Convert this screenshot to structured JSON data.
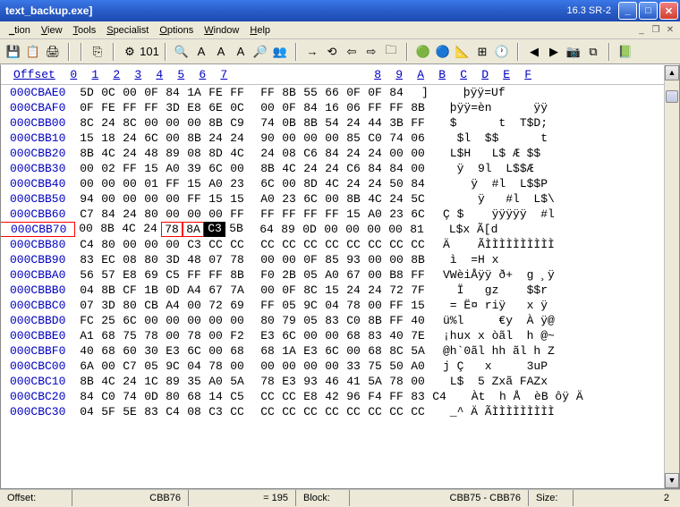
{
  "window": {
    "title": "text_backup.exe]",
    "version": "16.3 SR-2"
  },
  "menu": [
    "_tion",
    "View",
    "Tools",
    "Specialist",
    "Options",
    "Window",
    "Help"
  ],
  "toolbar_icons": [
    "💾",
    "📋",
    "🖨",
    "",
    "",
    "⎘",
    "",
    "⚙",
    "101",
    "",
    "🔍",
    "A",
    "A",
    "A",
    "🔎",
    "👥",
    "",
    "→",
    "⟲",
    "⇦",
    "⇨",
    "🗀",
    "",
    "🟢",
    "🔵",
    "📐",
    "⊞",
    "🕐",
    "",
    "◀",
    "▶",
    "📷",
    "⧉",
    "",
    "📗"
  ],
  "hex": {
    "header_offset": "Offset",
    "cols": [
      "0",
      "1",
      "2",
      "3",
      "4",
      "5",
      "6",
      "7",
      "8",
      "9",
      "A",
      "B",
      "C",
      "D",
      "E",
      "F"
    ],
    "rows": [
      {
        "o": "000CBAE0",
        "h": [
          "5D",
          "0C",
          "00",
          "0F",
          "84",
          "1A",
          "FE",
          "FF",
          "FF",
          "8B",
          "55",
          "66",
          "0F",
          "0F",
          "84"
        ],
        "a": "]     þÿÿ=Uf    "
      },
      {
        "o": "000CBAF0",
        "h": [
          "0F",
          "FE",
          "FF",
          "FF",
          "3D",
          "E8",
          "6E",
          "0C",
          "00",
          "0F",
          "84",
          "16",
          "06",
          "FF",
          "FF",
          "8B"
        ],
        "a": " þÿÿ=èn      ÿÿ "
      },
      {
        "o": "000CBB00",
        "h": [
          "8C",
          "24",
          "8C",
          "00",
          "00",
          "00",
          "8B",
          "C9",
          "74",
          "0B",
          "8B",
          "54",
          "24",
          "44",
          "3B",
          "FF"
        ],
        "a": " $      t  T$D; "
      },
      {
        "o": "000CBB10",
        "h": [
          "15",
          "18",
          "24",
          "6C",
          "00",
          "8B",
          "24",
          "24",
          "90",
          "00",
          "00",
          "00",
          "85",
          "C0",
          "74",
          "06"
        ],
        "a": "  $l  $$      t "
      },
      {
        "o": "000CBB20",
        "h": [
          "8B",
          "4C",
          "24",
          "48",
          "89",
          "08",
          "8D",
          "4C",
          "24",
          "08",
          "C6",
          "84",
          "24",
          "24",
          "00",
          "00"
        ],
        "a": " L$H   L$ Æ $$  "
      },
      {
        "o": "000CBB30",
        "h": [
          "00",
          "02",
          "FF",
          "15",
          "A0",
          "39",
          "6C",
          "00",
          "8B",
          "4C",
          "24",
          "24",
          "C6",
          "84",
          "84",
          "00"
        ],
        "a": "  ÿ  9l  L$$Æ   "
      },
      {
        "o": "000CBB40",
        "h": [
          "00",
          "00",
          "00",
          "01",
          "FF",
          "15",
          "A0",
          "23",
          "6C",
          "00",
          "8D",
          "4C",
          "24",
          "24",
          "50",
          "84"
        ],
        "a": "    ÿ  #l  L$$P "
      },
      {
        "o": "000CBB50",
        "h": [
          "94",
          "00",
          "00",
          "00",
          "00",
          "FF",
          "15",
          "15",
          "A0",
          "23",
          "6C",
          "00",
          "8B",
          "4C",
          "24",
          "5C"
        ],
        "a": "     ÿ   #l  L$\\"
      },
      {
        "o": "000CBB60",
        "h": [
          "C7",
          "84",
          "24",
          "80",
          "00",
          "00",
          "00",
          "FF",
          "FF",
          "FF",
          "FF",
          "FF",
          "15",
          "A0",
          "23",
          "6C"
        ],
        "a": "Ç $    ÿÿÿÿÿ  #l"
      },
      {
        "o": "000CBB70",
        "h": [
          "00",
          "8B",
          "4C",
          "24",
          "78",
          "8A",
          "C3",
          "5B",
          "64",
          "89",
          "0D",
          "00",
          "00",
          "00",
          "00",
          "81"
        ],
        "a": " L$x Ã[d        "
      },
      {
        "o": "000CBB80",
        "h": [
          "C4",
          "80",
          "00",
          "00",
          "00",
          "C3",
          "CC",
          "CC",
          "CC",
          "CC",
          "CC",
          "CC",
          "CC",
          "CC",
          "CC",
          "CC"
        ],
        "a": "Ä    ÃÌÌÌÌÌÌÌÌÌÌ"
      },
      {
        "o": "000CBB90",
        "h": [
          "83",
          "EC",
          "08",
          "80",
          "3D",
          "48",
          "07",
          "78",
          "00",
          "00",
          "0F",
          "85",
          "93",
          "00",
          "00",
          "8B"
        ],
        "a": " ì  =H x        "
      },
      {
        "o": "000CBBA0",
        "h": [
          "56",
          "57",
          "E8",
          "69",
          "C5",
          "FF",
          "FF",
          "8B",
          "F0",
          "2B",
          "05",
          "A0",
          "67",
          "00",
          "B8",
          "FF"
        ],
        "a": "VWèiÅÿÿ ð+  g ¸ÿ"
      },
      {
        "o": "000CBBB0",
        "h": [
          "04",
          "8B",
          "CF",
          "1B",
          "0D",
          "A4",
          "67",
          "7A",
          "00",
          "0F",
          "8C",
          "15",
          "24",
          "24",
          "72",
          "7F"
        ],
        "a": "  Ï   gz    $$r "
      },
      {
        "o": "000CBBC0",
        "h": [
          "07",
          "3D",
          "80",
          "CB",
          "A4",
          "00",
          "72",
          "69",
          "FF",
          "05",
          "9C",
          "04",
          "78",
          "00",
          "FF",
          "15"
        ],
        "a": " = Ë¤ riÿ   x ÿ "
      },
      {
        "o": "000CBBD0",
        "h": [
          "FC",
          "25",
          "6C",
          "00",
          "00",
          "00",
          "00",
          "00",
          "80",
          "79",
          "05",
          "83",
          "C0",
          "8B",
          "FF",
          "40"
        ],
        "a": "ü%l     €y  À ÿ@"
      },
      {
        "o": "000CBBE0",
        "h": [
          "A1",
          "68",
          "75",
          "78",
          "00",
          "78",
          "00",
          "F2",
          "E3",
          "6C",
          "00",
          "00",
          "68",
          "83",
          "40",
          "7E"
        ],
        "a": "¡hux x òãl  h @~"
      },
      {
        "o": "000CBBF0",
        "h": [
          "40",
          "68",
          "60",
          "30",
          "E3",
          "6C",
          "00",
          "68",
          "68",
          "1A",
          "E3",
          "6C",
          "00",
          "68",
          "8C",
          "5A"
        ],
        "a": "@h`0ãl hh ãl h Z"
      },
      {
        "o": "000CBC00",
        "h": [
          "6A",
          "00",
          "C7",
          "05",
          "9C",
          "04",
          "78",
          "00",
          "00",
          "00",
          "00",
          "00",
          "33",
          "75",
          "50",
          "A0"
        ],
        "a": "j Ç   x     3uP "
      },
      {
        "o": "000CBC10",
        "h": [
          "8B",
          "4C",
          "24",
          "1C",
          "89",
          "35",
          "A0",
          "5A",
          "78",
          "E3",
          "93",
          "46",
          "41",
          "5A",
          "78",
          "00"
        ],
        "a": " L$  5 Zxã FAZx "
      },
      {
        "o": "000CBC20",
        "h": [
          "84",
          "C0",
          "74",
          "0D",
          "80",
          "68",
          "14",
          "C5",
          "CC",
          "CC",
          "E8",
          "42",
          "96",
          "F4",
          "FF",
          "83",
          "C4"
        ],
        "a": " Àt  h Å  èB ôÿ Ä"
      },
      {
        "o": "000CBC30",
        "h": [
          "04",
          "5F",
          "5E",
          "83",
          "C4",
          "08",
          "C3",
          "CC",
          "CC",
          "CC",
          "CC",
          "CC",
          "CC",
          "CC",
          "CC",
          "CC"
        ],
        "a": " _^ Ä ÃÌÌÌÌÌÌÌÌÌ"
      }
    ],
    "highlight_row": "000CBB70",
    "box_cols": [
      4,
      5
    ],
    "cursor": {
      "row": "000CBB70",
      "col": 6
    }
  },
  "status": {
    "offset_label": "Offset:",
    "offset_value": "CBB76",
    "eq_value": "= 195",
    "block_label": "Block:",
    "block_value": "CBB75 - CBB76",
    "size_label": "Size:",
    "size_value": "2"
  }
}
